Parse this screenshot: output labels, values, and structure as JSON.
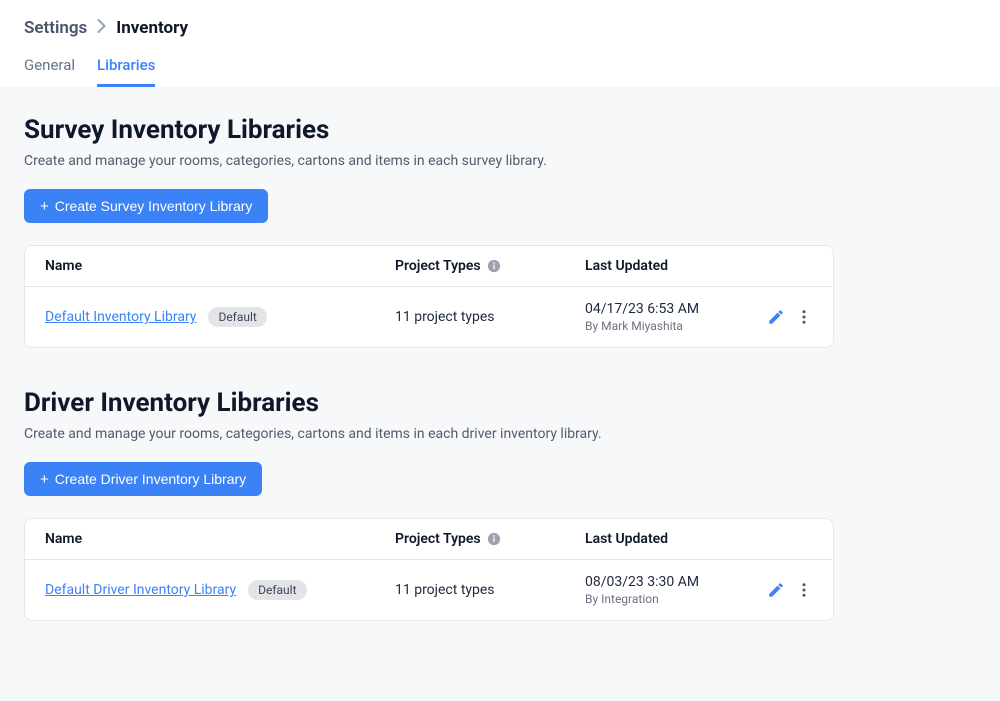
{
  "breadcrumb": {
    "parent": "Settings",
    "current": "Inventory"
  },
  "tabs": {
    "general": "General",
    "libraries": "Libraries"
  },
  "survey": {
    "title": "Survey Inventory Libraries",
    "description": "Create and manage your rooms, categories, cartons and items in each survey library.",
    "create_label": "Create Survey Inventory Library",
    "columns": {
      "name": "Name",
      "types": "Project Types",
      "updated": "Last Updated"
    },
    "row": {
      "name": "Default Inventory Library",
      "badge": "Default",
      "types": "11 project types",
      "updated_date": "04/17/23 6:53 AM",
      "updated_by": "By Mark Miyashita"
    }
  },
  "driver": {
    "title": "Driver Inventory Libraries",
    "description": "Create and manage your rooms, categories, cartons and items in each driver inventory library.",
    "create_label": "Create Driver Inventory Library",
    "columns": {
      "name": "Name",
      "types": "Project Types",
      "updated": "Last Updated"
    },
    "row": {
      "name": "Default Driver Inventory Library",
      "badge": "Default",
      "types": "11 project types",
      "updated_date": "08/03/23 3:30 AM",
      "updated_by": "By Integration"
    }
  }
}
